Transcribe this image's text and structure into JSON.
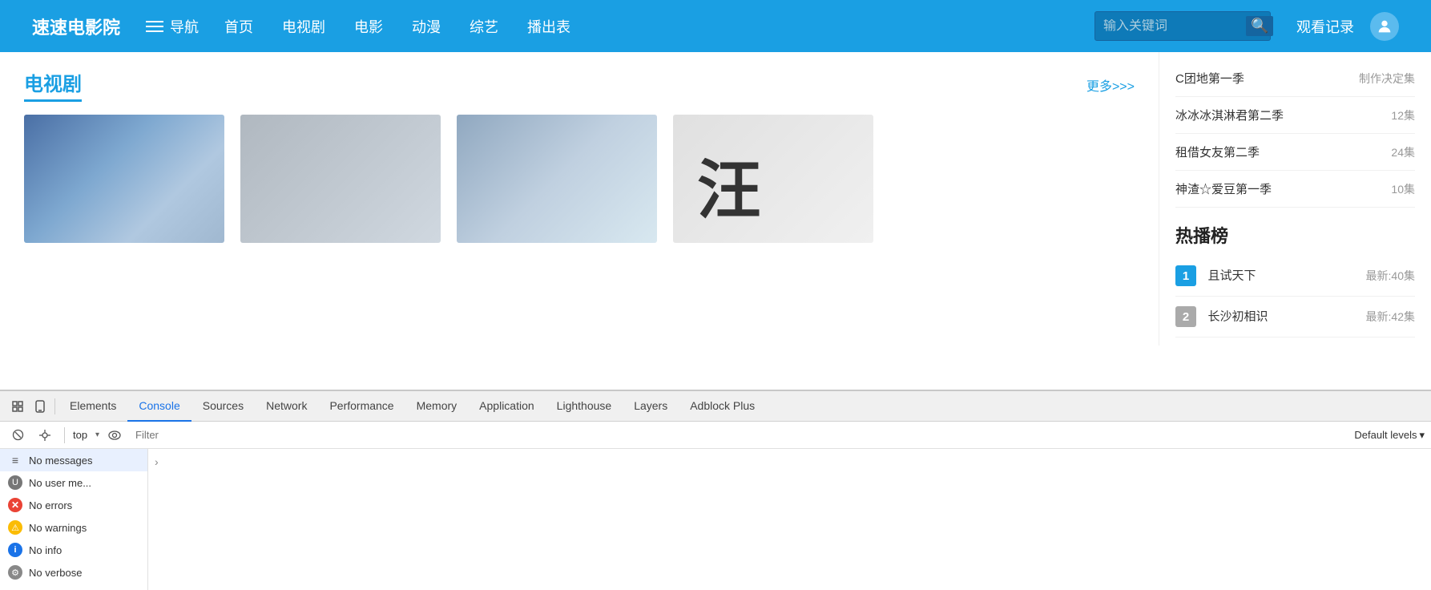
{
  "navbar": {
    "brand": "速速电影院",
    "nav_label": "导航",
    "links": [
      "首页",
      "电视剧",
      "电影",
      "动漫",
      "综艺",
      "播出表"
    ],
    "search_placeholder": "输入关键词",
    "watch_history": "观看记录"
  },
  "right_panel": {
    "items": [
      {
        "title": "C团地第一季",
        "episodes": "制作决定集"
      },
      {
        "title": "冰冰冰淇淋君第二季",
        "episodes": "12集"
      },
      {
        "title": "租借女友第二季",
        "episodes": "24集"
      },
      {
        "title": "神渣☆爱豆第一季",
        "episodes": "10集"
      }
    ],
    "hot_section_title": "热播榜",
    "hot_items": [
      {
        "rank": "1",
        "title": "且试天下",
        "episodes": "最新:40集",
        "rank_class": "rank1"
      },
      {
        "rank": "2",
        "title": "长沙初相识",
        "episodes": "最新:42集",
        "rank_class": "rank2"
      }
    ]
  },
  "content_section": {
    "title": "电视剧",
    "more_label": "更多>>>"
  },
  "devtools": {
    "tabs": [
      {
        "label": "Elements",
        "active": false
      },
      {
        "label": "Console",
        "active": true
      },
      {
        "label": "Sources",
        "active": false
      },
      {
        "label": "Network",
        "active": false
      },
      {
        "label": "Performance",
        "active": false
      },
      {
        "label": "Memory",
        "active": false
      },
      {
        "label": "Application",
        "active": false
      },
      {
        "label": "Lighthouse",
        "active": false
      },
      {
        "label": "Layers",
        "active": false
      },
      {
        "label": "Adblock Plus",
        "active": false
      }
    ],
    "console_select": "top",
    "filter_placeholder": "Filter",
    "levels_label": "Default levels",
    "sidebar_items": [
      {
        "label": "No messages",
        "icon_type": "messages",
        "icon_char": "≡",
        "active": true
      },
      {
        "label": "No user me...",
        "icon_type": "user",
        "icon_char": "U"
      },
      {
        "label": "No errors",
        "icon_type": "error",
        "icon_char": "✕"
      },
      {
        "label": "No warnings",
        "icon_type": "warning",
        "icon_char": "!"
      },
      {
        "label": "No info",
        "icon_type": "info",
        "icon_char": "i"
      },
      {
        "label": "No verbose",
        "icon_type": "verbose",
        "icon_char": "⚙"
      }
    ]
  }
}
